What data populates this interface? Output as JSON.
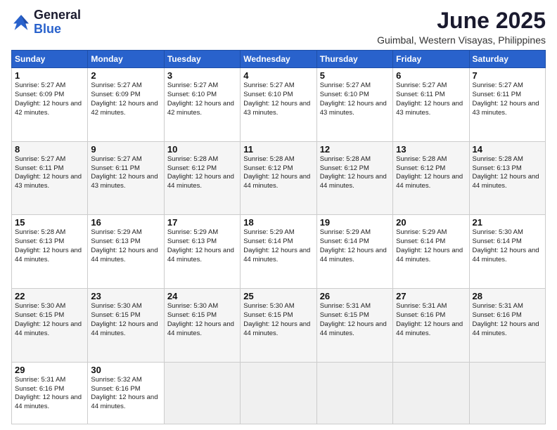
{
  "logo": {
    "general": "General",
    "blue": "Blue"
  },
  "title": "June 2025",
  "location": "Guimbal, Western Visayas, Philippines",
  "days_header": [
    "Sunday",
    "Monday",
    "Tuesday",
    "Wednesday",
    "Thursday",
    "Friday",
    "Saturday"
  ],
  "weeks": [
    [
      {
        "day": "1",
        "sunrise": "Sunrise: 5:27 AM",
        "sunset": "Sunset: 6:09 PM",
        "daylight": "Daylight: 12 hours and 42 minutes."
      },
      {
        "day": "2",
        "sunrise": "Sunrise: 5:27 AM",
        "sunset": "Sunset: 6:09 PM",
        "daylight": "Daylight: 12 hours and 42 minutes."
      },
      {
        "day": "3",
        "sunrise": "Sunrise: 5:27 AM",
        "sunset": "Sunset: 6:10 PM",
        "daylight": "Daylight: 12 hours and 42 minutes."
      },
      {
        "day": "4",
        "sunrise": "Sunrise: 5:27 AM",
        "sunset": "Sunset: 6:10 PM",
        "daylight": "Daylight: 12 hours and 43 minutes."
      },
      {
        "day": "5",
        "sunrise": "Sunrise: 5:27 AM",
        "sunset": "Sunset: 6:10 PM",
        "daylight": "Daylight: 12 hours and 43 minutes."
      },
      {
        "day": "6",
        "sunrise": "Sunrise: 5:27 AM",
        "sunset": "Sunset: 6:11 PM",
        "daylight": "Daylight: 12 hours and 43 minutes."
      },
      {
        "day": "7",
        "sunrise": "Sunrise: 5:27 AM",
        "sunset": "Sunset: 6:11 PM",
        "daylight": "Daylight: 12 hours and 43 minutes."
      }
    ],
    [
      {
        "day": "8",
        "sunrise": "Sunrise: 5:27 AM",
        "sunset": "Sunset: 6:11 PM",
        "daylight": "Daylight: 12 hours and 43 minutes."
      },
      {
        "day": "9",
        "sunrise": "Sunrise: 5:27 AM",
        "sunset": "Sunset: 6:11 PM",
        "daylight": "Daylight: 12 hours and 43 minutes."
      },
      {
        "day": "10",
        "sunrise": "Sunrise: 5:28 AM",
        "sunset": "Sunset: 6:12 PM",
        "daylight": "Daylight: 12 hours and 44 minutes."
      },
      {
        "day": "11",
        "sunrise": "Sunrise: 5:28 AM",
        "sunset": "Sunset: 6:12 PM",
        "daylight": "Daylight: 12 hours and 44 minutes."
      },
      {
        "day": "12",
        "sunrise": "Sunrise: 5:28 AM",
        "sunset": "Sunset: 6:12 PM",
        "daylight": "Daylight: 12 hours and 44 minutes."
      },
      {
        "day": "13",
        "sunrise": "Sunrise: 5:28 AM",
        "sunset": "Sunset: 6:12 PM",
        "daylight": "Daylight: 12 hours and 44 minutes."
      },
      {
        "day": "14",
        "sunrise": "Sunrise: 5:28 AM",
        "sunset": "Sunset: 6:13 PM",
        "daylight": "Daylight: 12 hours and 44 minutes."
      }
    ],
    [
      {
        "day": "15",
        "sunrise": "Sunrise: 5:28 AM",
        "sunset": "Sunset: 6:13 PM",
        "daylight": "Daylight: 12 hours and 44 minutes."
      },
      {
        "day": "16",
        "sunrise": "Sunrise: 5:29 AM",
        "sunset": "Sunset: 6:13 PM",
        "daylight": "Daylight: 12 hours and 44 minutes."
      },
      {
        "day": "17",
        "sunrise": "Sunrise: 5:29 AM",
        "sunset": "Sunset: 6:13 PM",
        "daylight": "Daylight: 12 hours and 44 minutes."
      },
      {
        "day": "18",
        "sunrise": "Sunrise: 5:29 AM",
        "sunset": "Sunset: 6:14 PM",
        "daylight": "Daylight: 12 hours and 44 minutes."
      },
      {
        "day": "19",
        "sunrise": "Sunrise: 5:29 AM",
        "sunset": "Sunset: 6:14 PM",
        "daylight": "Daylight: 12 hours and 44 minutes."
      },
      {
        "day": "20",
        "sunrise": "Sunrise: 5:29 AM",
        "sunset": "Sunset: 6:14 PM",
        "daylight": "Daylight: 12 hours and 44 minutes."
      },
      {
        "day": "21",
        "sunrise": "Sunrise: 5:30 AM",
        "sunset": "Sunset: 6:14 PM",
        "daylight": "Daylight: 12 hours and 44 minutes."
      }
    ],
    [
      {
        "day": "22",
        "sunrise": "Sunrise: 5:30 AM",
        "sunset": "Sunset: 6:15 PM",
        "daylight": "Daylight: 12 hours and 44 minutes."
      },
      {
        "day": "23",
        "sunrise": "Sunrise: 5:30 AM",
        "sunset": "Sunset: 6:15 PM",
        "daylight": "Daylight: 12 hours and 44 minutes."
      },
      {
        "day": "24",
        "sunrise": "Sunrise: 5:30 AM",
        "sunset": "Sunset: 6:15 PM",
        "daylight": "Daylight: 12 hours and 44 minutes."
      },
      {
        "day": "25",
        "sunrise": "Sunrise: 5:30 AM",
        "sunset": "Sunset: 6:15 PM",
        "daylight": "Daylight: 12 hours and 44 minutes."
      },
      {
        "day": "26",
        "sunrise": "Sunrise: 5:31 AM",
        "sunset": "Sunset: 6:15 PM",
        "daylight": "Daylight: 12 hours and 44 minutes."
      },
      {
        "day": "27",
        "sunrise": "Sunrise: 5:31 AM",
        "sunset": "Sunset: 6:16 PM",
        "daylight": "Daylight: 12 hours and 44 minutes."
      },
      {
        "day": "28",
        "sunrise": "Sunrise: 5:31 AM",
        "sunset": "Sunset: 6:16 PM",
        "daylight": "Daylight: 12 hours and 44 minutes."
      }
    ],
    [
      {
        "day": "29",
        "sunrise": "Sunrise: 5:31 AM",
        "sunset": "Sunset: 6:16 PM",
        "daylight": "Daylight: 12 hours and 44 minutes."
      },
      {
        "day": "30",
        "sunrise": "Sunrise: 5:32 AM",
        "sunset": "Sunset: 6:16 PM",
        "daylight": "Daylight: 12 hours and 44 minutes."
      },
      null,
      null,
      null,
      null,
      null
    ]
  ]
}
